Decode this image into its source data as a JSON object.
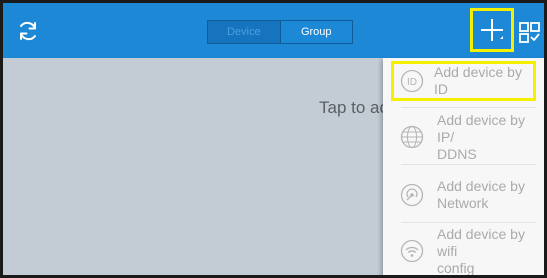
{
  "header": {
    "segment_device": "Device",
    "segment_group": "Group"
  },
  "main": {
    "empty_hint": "Tap to ac"
  },
  "menu": {
    "items": [
      {
        "label_line1": "Add device by ID",
        "label_line2": "",
        "icon": "id-icon"
      },
      {
        "label_line1": "Add device by IP/",
        "label_line2": "DDNS",
        "icon": "globe-icon"
      },
      {
        "label_line1": "Add device by",
        "label_line2": "Network",
        "icon": "network-icon"
      },
      {
        "label_line1": "Add device by wifi",
        "label_line2": "config",
        "icon": "wifi-icon"
      }
    ]
  },
  "colors": {
    "header": "#1d88d6",
    "background": "#c3ccd4",
    "highlight": "#f5f000",
    "menu_text": "#aaaaaa"
  }
}
